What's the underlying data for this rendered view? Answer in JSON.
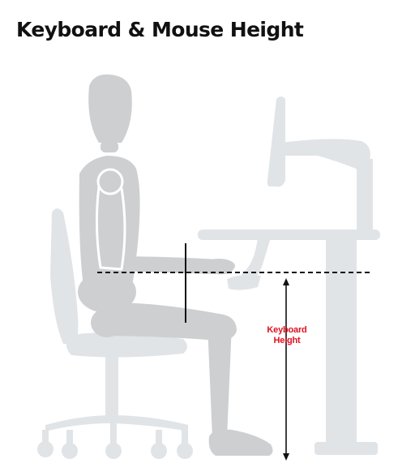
{
  "title": "Keyboard & Mouse Height",
  "measurement": {
    "line1": "Keyboard",
    "line2": "Height"
  },
  "colors": {
    "figure": "#cdcfd1",
    "furniture": "#e1e4e7",
    "outline": "#ffffff",
    "guide_line": "#111111",
    "label": "#e0101e"
  }
}
